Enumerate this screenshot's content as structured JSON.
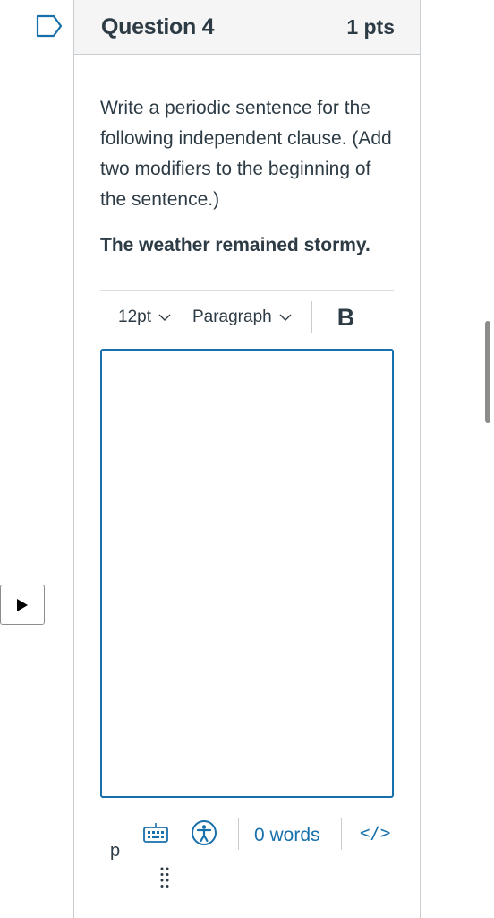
{
  "question": {
    "title": "Question 4",
    "points": "1 pts",
    "prompt": "Write a periodic sentence for the following independent clause. (Add two modifiers to the beginning of the sentence.)",
    "clause": "The weather remained stormy."
  },
  "editor": {
    "font_size": "12pt",
    "block_format": "Paragraph",
    "bold_label": "B",
    "path": "p",
    "word_count": "0 words",
    "html_toggle": "</>",
    "value": ""
  },
  "icons": {
    "flag": "bookmark-flag-icon",
    "keyboard": "keyboard-icon",
    "accessibility": "accessibility-icon",
    "grip": "resize-grip-icon",
    "play": "play-icon"
  },
  "colors": {
    "accent": "#1770ab",
    "text": "#2d3b45",
    "header_bg": "#f5f5f5",
    "border": "#c7cdd1"
  }
}
